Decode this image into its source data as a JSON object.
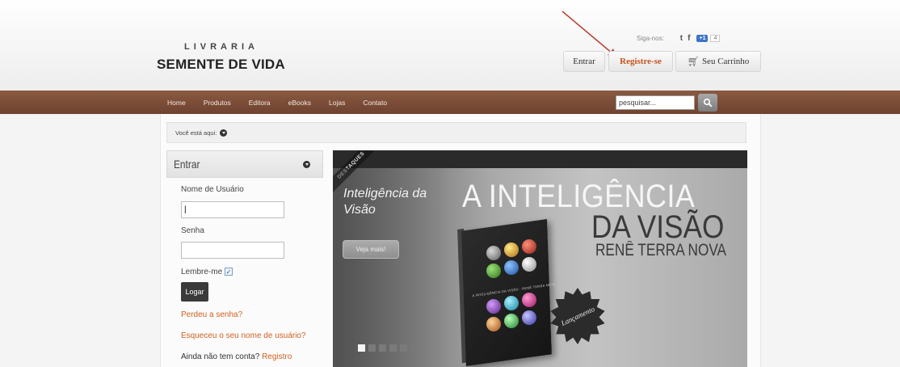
{
  "brand": {
    "top": "LIVRARIA",
    "bottom": "SEMENTE DE VIDA"
  },
  "social": {
    "label": "Siga-nos:",
    "twitter_icon": "t",
    "facebook_icon": "f",
    "gplus_label": "+1",
    "gplus_count": "4"
  },
  "header_buttons": {
    "entrar": "Entrar",
    "registre": "Registre-se",
    "carrinho": "Seu Carrinho"
  },
  "nav": {
    "items": [
      "Home",
      "Produtos",
      "Editora",
      "eBooks",
      "Lojas",
      "Contato"
    ]
  },
  "search": {
    "value": "pesquisar..."
  },
  "breadcrumb": {
    "label": "Você está aqui:"
  },
  "login": {
    "title": "Entrar",
    "username_label": "Nome de Usuário",
    "username_value": "|",
    "password_label": "Senha",
    "remember_label": "Lembre-me",
    "remember_checked": true,
    "submit_label": "Logar",
    "forgot_password": "Perdeu a senha?",
    "forgot_username": "Esqueceu o seu nome de usuário?",
    "no_account": "Ainda não tem conta?",
    "register_link": "Registro"
  },
  "slider": {
    "ribbon": "DESTAQUES",
    "caption": "Inteligência da Visão",
    "button": "Veja mais!",
    "headline_1": "A INTELIGÊNCIA",
    "headline_2": "DA VISÃO",
    "author": "RENÊ TERRA NOVA",
    "book_text": "A INTELIGÊNCIA DA VISÃO · RENÊ TERRA NOVA",
    "seal": "Lançamento",
    "slide_count": 5,
    "active_slide": 1
  },
  "colors": {
    "nav_bar": "#7a4b37",
    "accent_link": "#d2601f",
    "annotation_arrow": "#b5483a"
  }
}
